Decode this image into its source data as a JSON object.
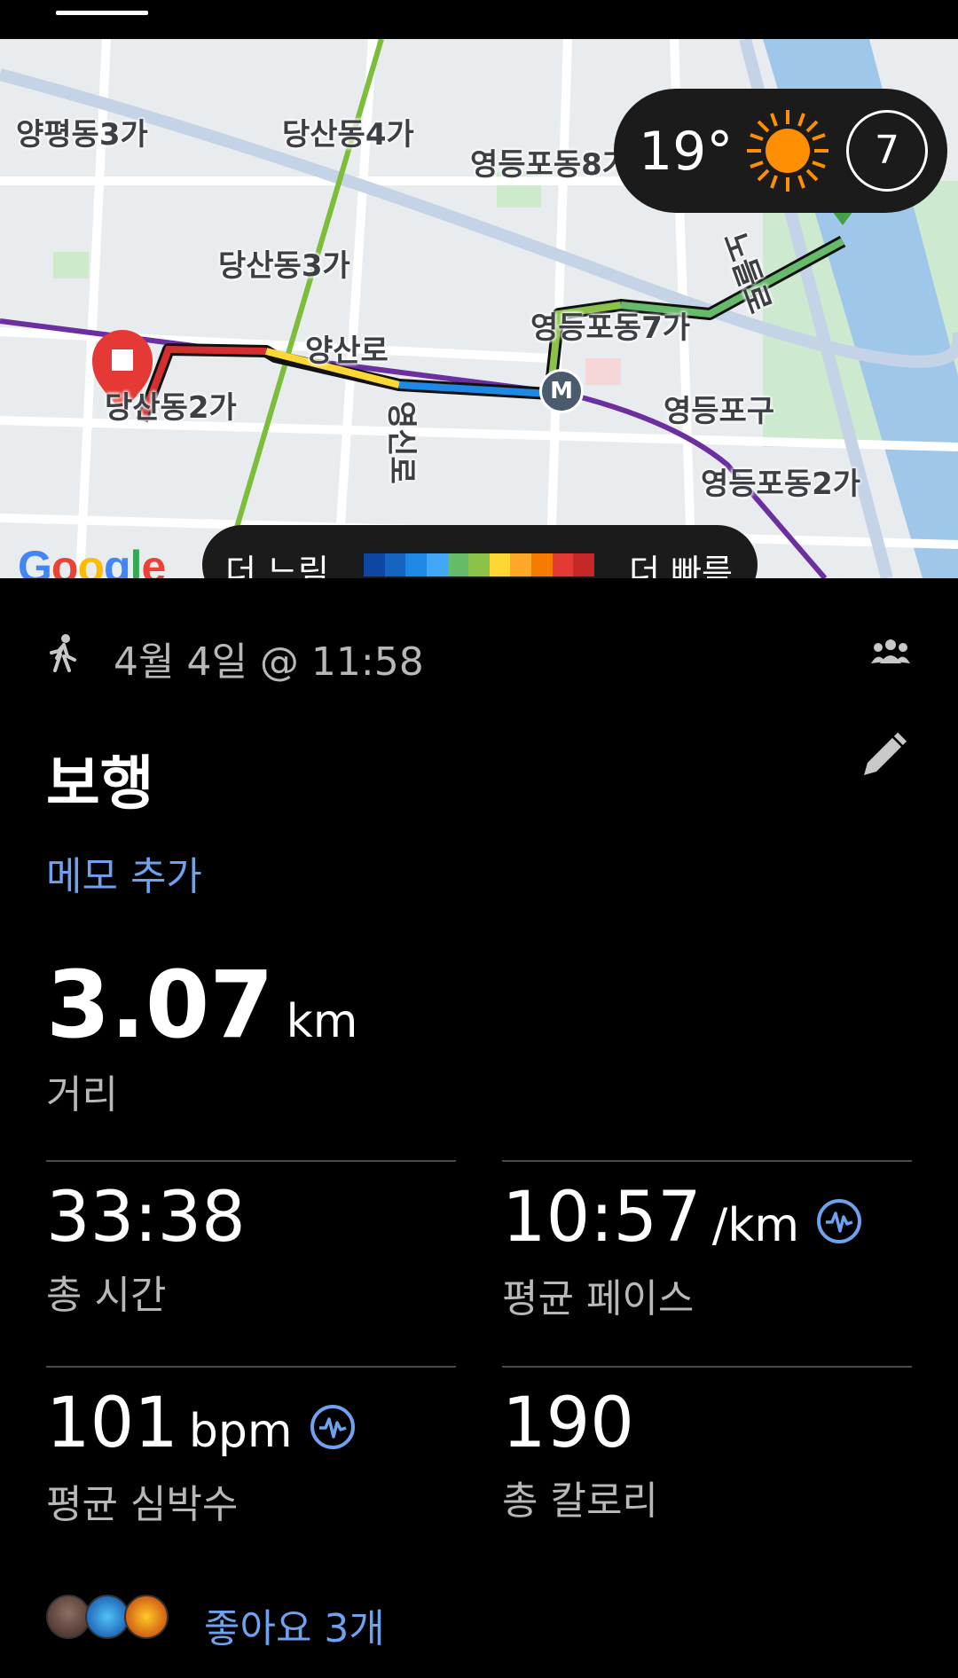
{
  "map": {
    "labels": [
      {
        "id": "yangpyeong3",
        "text": "양평동3가"
      },
      {
        "id": "dangsan4",
        "text": "당산동4가"
      },
      {
        "id": "yeongdeungpo8",
        "text": "영등포동8가"
      },
      {
        "id": "dangsan3",
        "text": "당산동3가"
      },
      {
        "id": "yeongdeungpo7",
        "text": "영등포동7가"
      },
      {
        "id": "yangsanro",
        "text": "양산로"
      },
      {
        "id": "yeongsinro",
        "text": "영신로"
      },
      {
        "id": "nodeulro",
        "text": "노들로"
      },
      {
        "id": "dangsan2",
        "text": "당산동2가"
      },
      {
        "id": "yeongdeungpogu",
        "text": "영등포구"
      },
      {
        "id": "yeongdeungpo2",
        "text": "영등포동2가"
      }
    ],
    "metro_badge": "M",
    "google_logo": [
      "G",
      "o",
      "o",
      "g",
      "l",
      "e"
    ],
    "weather": {
      "temperature": "19°",
      "uv_index": "7",
      "icon": "sun-icon"
    },
    "pace_legend": {
      "slow_label": "더 느림",
      "fast_label": "더 빠름",
      "colors": [
        "#0d47a1",
        "#1565c0",
        "#1e88e5",
        "#42a5f5",
        "#66bb6a",
        "#8bc34a",
        "#fdd835",
        "#ffa726",
        "#f57c00",
        "#e53935",
        "#c62828"
      ]
    }
  },
  "activity": {
    "type_icon": "walk-icon",
    "date": "4월 4일 @ 11:58",
    "title": "보행",
    "add_memo": "메모 추가",
    "distance": {
      "value": "3.07",
      "unit": "km",
      "label": "거리"
    },
    "stats": [
      {
        "id": "total-time",
        "value": "33:38",
        "unit": "",
        "label": "총 시간",
        "has_pulse_icon": false
      },
      {
        "id": "avg-pace",
        "value": "10:57",
        "unit": "/km",
        "label": "평균 페이스",
        "has_pulse_icon": true
      },
      {
        "id": "avg-heart-rate",
        "value": "101",
        "unit": "bpm",
        "label": "평균 심박수",
        "has_pulse_icon": true
      },
      {
        "id": "total-calories",
        "value": "190",
        "unit": "",
        "label": "총 칼로리",
        "has_pulse_icon": false
      }
    ],
    "likes_text": "좋아요 3개"
  },
  "colors": {
    "accent": "#6ea1ee",
    "route_red": "#d32f2f",
    "map_bg": "#eceff1"
  }
}
